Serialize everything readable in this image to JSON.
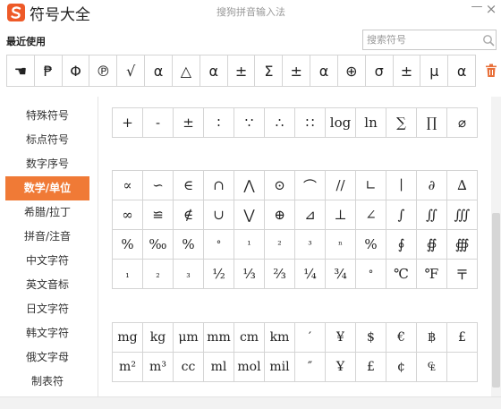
{
  "window": {
    "title": "符号大全",
    "brand": "搜狗拼音输入法",
    "minimize": "—",
    "close": "×"
  },
  "recent": {
    "title": "最近使用",
    "symbols": [
      "☚",
      "₱",
      "Φ",
      "℗",
      "√",
      "α",
      "△",
      "α",
      "±",
      "Σ",
      "±",
      "α",
      "⊕",
      "σ",
      "±",
      "μ",
      "α"
    ]
  },
  "search": {
    "placeholder": "搜索符号"
  },
  "sidebar": {
    "items": [
      {
        "label": "特殊符号"
      },
      {
        "label": "标点符号"
      },
      {
        "label": "数字序号"
      },
      {
        "label": "数学/单位"
      },
      {
        "label": "希腊/拉丁"
      },
      {
        "label": "拼音/注音"
      },
      {
        "label": "中文字符"
      },
      {
        "label": "英文音标"
      },
      {
        "label": "日文字符"
      },
      {
        "label": "韩文字符"
      },
      {
        "label": "俄文字母"
      },
      {
        "label": "制表符"
      }
    ],
    "active_index": 3,
    "active_color": "#f07a36"
  },
  "grid_top": [
    [
      "+",
      "-",
      "±",
      "∶",
      "∵",
      "∴",
      "∷",
      "log",
      "ln",
      "∑",
      "∏",
      "⌀"
    ]
  ],
  "grid_math": [
    [
      "∝",
      "∽",
      "∈",
      "∩",
      "⋀",
      "⊙",
      "⌒",
      "//",
      "∟",
      "∣",
      "∂",
      "∆"
    ],
    [
      "∞",
      "≌",
      "∉",
      "∪",
      "⋁",
      "⊕",
      "⊿",
      "⊥",
      "∠",
      "∫",
      "∬",
      "∭"
    ],
    [
      "%",
      "‰",
      "%",
      "°",
      "¹",
      "²",
      "³",
      "ⁿ",
      "%",
      "∮",
      "∯",
      "∰"
    ],
    [
      "₁",
      "₂",
      "₃",
      "½",
      "⅓",
      "⅔",
      "¼",
      "¾",
      "°",
      "℃",
      "℉",
      "〒"
    ]
  ],
  "grid_units": [
    [
      "mg",
      "kg",
      "μm",
      "mm",
      "cm",
      "km",
      "′",
      "¥",
      "$",
      "€",
      "฿",
      "£"
    ],
    [
      "m²",
      "m³",
      "cc",
      "ml",
      "mol",
      "mil",
      "″",
      "Ұ",
      "£",
      "¢",
      "₠",
      ""
    ]
  ],
  "colors": {
    "accent": "#f07a36",
    "logo": "#ee5a28",
    "trash": "#e8703a"
  },
  "icons": {
    "logo": "sogou-logo-icon",
    "search": "search-icon",
    "trash": "trash-icon"
  }
}
